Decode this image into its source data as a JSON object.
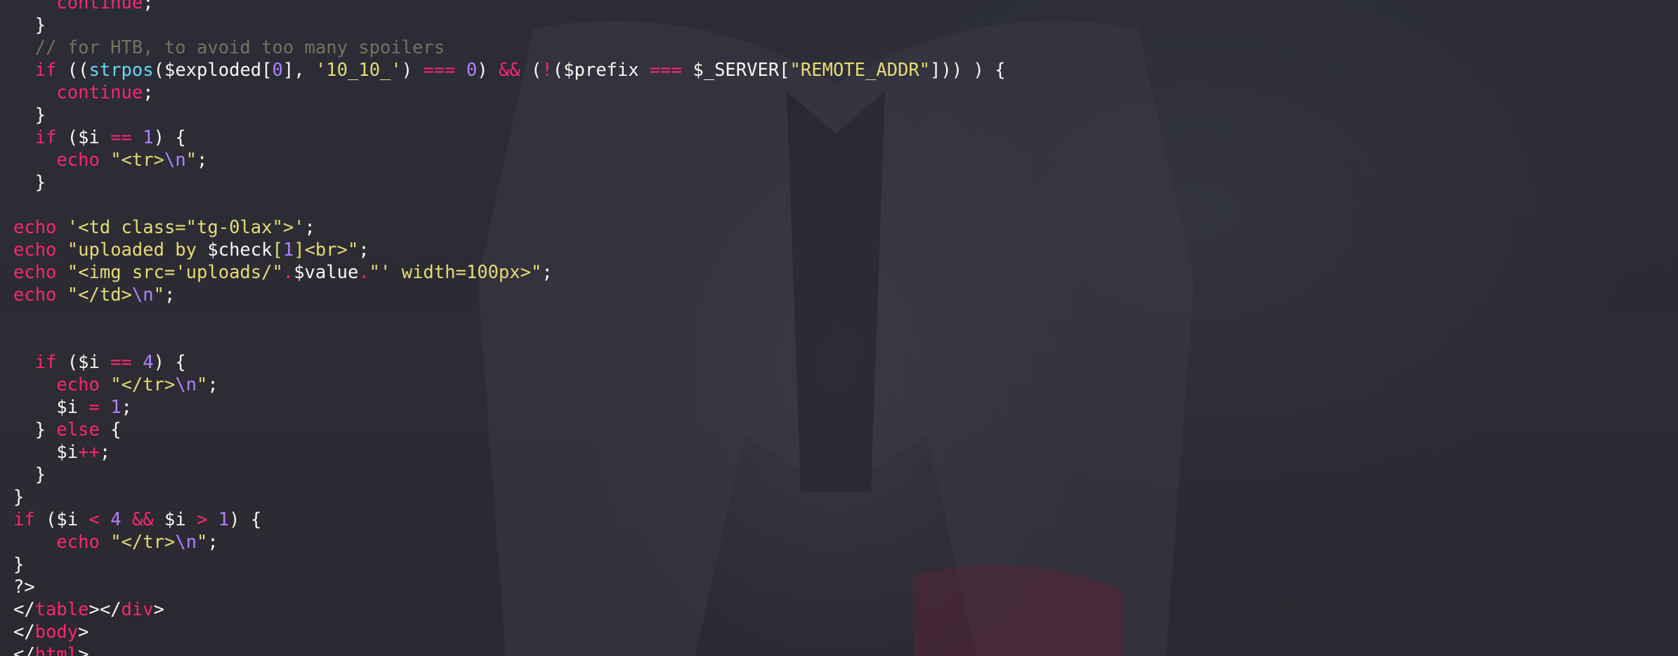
{
  "window": {
    "wallpaper": "matador-costume-photo",
    "theme_colors": {
      "background": "#2b2c36",
      "keyword": "#f92672",
      "string": "#e6db74",
      "number": "#ae81ff",
      "function": "#66d9ef",
      "comment": "#75715e",
      "text": "#f8f8f2"
    }
  },
  "editor": {
    "language": "php",
    "lines": [
      [
        {
          "t": "    ",
          "c": "p"
        },
        {
          "t": "continue",
          "c": "k"
        },
        {
          "t": ";",
          "c": "p"
        }
      ],
      [
        {
          "t": "  }",
          "c": "p"
        }
      ],
      [
        {
          "t": "  // for HTB, to avoid too many spoilers",
          "c": "c"
        }
      ],
      [
        {
          "t": "  ",
          "c": "p"
        },
        {
          "t": "if",
          "c": "k"
        },
        {
          "t": " ((",
          "c": "p"
        },
        {
          "t": "strpos",
          "c": "f"
        },
        {
          "t": "($exploded[",
          "c": "p"
        },
        {
          "t": "0",
          "c": "n"
        },
        {
          "t": "], ",
          "c": "p"
        },
        {
          "t": "'10_10_'",
          "c": "s"
        },
        {
          "t": ") ",
          "c": "p"
        },
        {
          "t": "===",
          "c": "k"
        },
        {
          "t": " ",
          "c": "p"
        },
        {
          "t": "0",
          "c": "n"
        },
        {
          "t": ") ",
          "c": "p"
        },
        {
          "t": "&&",
          "c": "k"
        },
        {
          "t": " (",
          "c": "p"
        },
        {
          "t": "!",
          "c": "k"
        },
        {
          "t": "($prefix ",
          "c": "p"
        },
        {
          "t": "===",
          "c": "k"
        },
        {
          "t": " $_SERVER[",
          "c": "p"
        },
        {
          "t": "\"REMOTE_ADDR\"",
          "c": "s"
        },
        {
          "t": "])) ) {",
          "c": "p"
        }
      ],
      [
        {
          "t": "    ",
          "c": "p"
        },
        {
          "t": "continue",
          "c": "k"
        },
        {
          "t": ";",
          "c": "p"
        }
      ],
      [
        {
          "t": "  }",
          "c": "p"
        }
      ],
      [
        {
          "t": "  ",
          "c": "p"
        },
        {
          "t": "if",
          "c": "k"
        },
        {
          "t": " ($i ",
          "c": "p"
        },
        {
          "t": "==",
          "c": "k"
        },
        {
          "t": " ",
          "c": "p"
        },
        {
          "t": "1",
          "c": "n"
        },
        {
          "t": ") {",
          "c": "p"
        }
      ],
      [
        {
          "t": "    ",
          "c": "p"
        },
        {
          "t": "echo",
          "c": "k"
        },
        {
          "t": " ",
          "c": "p"
        },
        {
          "t": "\"<tr>",
          "c": "s"
        },
        {
          "t": "\\n",
          "c": "n"
        },
        {
          "t": "\"",
          "c": "s"
        },
        {
          "t": ";",
          "c": "p"
        }
      ],
      [
        {
          "t": "  }",
          "c": "p"
        }
      ],
      [],
      [
        {
          "t": "echo",
          "c": "k"
        },
        {
          "t": " ",
          "c": "p"
        },
        {
          "t": "'<td class=\"tg-0lax\">'",
          "c": "s"
        },
        {
          "t": ";",
          "c": "p"
        }
      ],
      [
        {
          "t": "echo",
          "c": "k"
        },
        {
          "t": " ",
          "c": "p"
        },
        {
          "t": "\"uploaded by ",
          "c": "s"
        },
        {
          "t": "$check",
          "c": "p"
        },
        {
          "t": "[",
          "c": "s"
        },
        {
          "t": "1",
          "c": "n"
        },
        {
          "t": "]<br>\"",
          "c": "s"
        },
        {
          "t": ";",
          "c": "p"
        }
      ],
      [
        {
          "t": "echo",
          "c": "k"
        },
        {
          "t": " ",
          "c": "p"
        },
        {
          "t": "\"<img src='uploads/\"",
          "c": "s"
        },
        {
          "t": ".",
          "c": "k"
        },
        {
          "t": "$value",
          "c": "p"
        },
        {
          "t": ".",
          "c": "k"
        },
        {
          "t": "\"' width=100px>\"",
          "c": "s"
        },
        {
          "t": ";",
          "c": "p"
        }
      ],
      [
        {
          "t": "echo",
          "c": "k"
        },
        {
          "t": " ",
          "c": "p"
        },
        {
          "t": "\"</td>",
          "c": "s"
        },
        {
          "t": "\\n",
          "c": "n"
        },
        {
          "t": "\"",
          "c": "s"
        },
        {
          "t": ";",
          "c": "p"
        }
      ],
      [],
      [],
      [
        {
          "t": "  ",
          "c": "p"
        },
        {
          "t": "if",
          "c": "k"
        },
        {
          "t": " ($i ",
          "c": "p"
        },
        {
          "t": "==",
          "c": "k"
        },
        {
          "t": " ",
          "c": "p"
        },
        {
          "t": "4",
          "c": "n"
        },
        {
          "t": ") {",
          "c": "p"
        }
      ],
      [
        {
          "t": "    ",
          "c": "p"
        },
        {
          "t": "echo",
          "c": "k"
        },
        {
          "t": " ",
          "c": "p"
        },
        {
          "t": "\"</tr>",
          "c": "s"
        },
        {
          "t": "\\n",
          "c": "n"
        },
        {
          "t": "\"",
          "c": "s"
        },
        {
          "t": ";",
          "c": "p"
        }
      ],
      [
        {
          "t": "    $i ",
          "c": "p"
        },
        {
          "t": "=",
          "c": "k"
        },
        {
          "t": " ",
          "c": "p"
        },
        {
          "t": "1",
          "c": "n"
        },
        {
          "t": ";",
          "c": "p"
        }
      ],
      [
        {
          "t": "  } ",
          "c": "p"
        },
        {
          "t": "else",
          "c": "k"
        },
        {
          "t": " {",
          "c": "p"
        }
      ],
      [
        {
          "t": "    $i",
          "c": "p"
        },
        {
          "t": "++",
          "c": "k"
        },
        {
          "t": ";",
          "c": "p"
        }
      ],
      [
        {
          "t": "  }",
          "c": "p"
        }
      ],
      [
        {
          "t": "}",
          "c": "p"
        }
      ],
      [
        {
          "t": "if",
          "c": "k"
        },
        {
          "t": " ($i ",
          "c": "p"
        },
        {
          "t": "<",
          "c": "k"
        },
        {
          "t": " ",
          "c": "p"
        },
        {
          "t": "4",
          "c": "n"
        },
        {
          "t": " ",
          "c": "p"
        },
        {
          "t": "&&",
          "c": "k"
        },
        {
          "t": " $i ",
          "c": "p"
        },
        {
          "t": ">",
          "c": "k"
        },
        {
          "t": " ",
          "c": "p"
        },
        {
          "t": "1",
          "c": "n"
        },
        {
          "t": ") {",
          "c": "p"
        }
      ],
      [
        {
          "t": "    ",
          "c": "p"
        },
        {
          "t": "echo",
          "c": "k"
        },
        {
          "t": " ",
          "c": "p"
        },
        {
          "t": "\"</tr>",
          "c": "s"
        },
        {
          "t": "\\n",
          "c": "n"
        },
        {
          "t": "\"",
          "c": "s"
        },
        {
          "t": ";",
          "c": "p"
        }
      ],
      [
        {
          "t": "}",
          "c": "p"
        }
      ],
      [
        {
          "t": "?>",
          "c": "p"
        }
      ],
      [
        {
          "t": "</",
          "c": "p"
        },
        {
          "t": "table",
          "c": "k"
        },
        {
          "t": "></",
          "c": "p"
        },
        {
          "t": "div",
          "c": "k"
        },
        {
          "t": ">",
          "c": "p"
        }
      ],
      [
        {
          "t": "</",
          "c": "p"
        },
        {
          "t": "body",
          "c": "k"
        },
        {
          "t": ">",
          "c": "p"
        }
      ],
      [
        {
          "t": "</",
          "c": "p"
        },
        {
          "t": "html",
          "c": "k"
        },
        {
          "t": ">",
          "c": "p"
        }
      ]
    ]
  }
}
